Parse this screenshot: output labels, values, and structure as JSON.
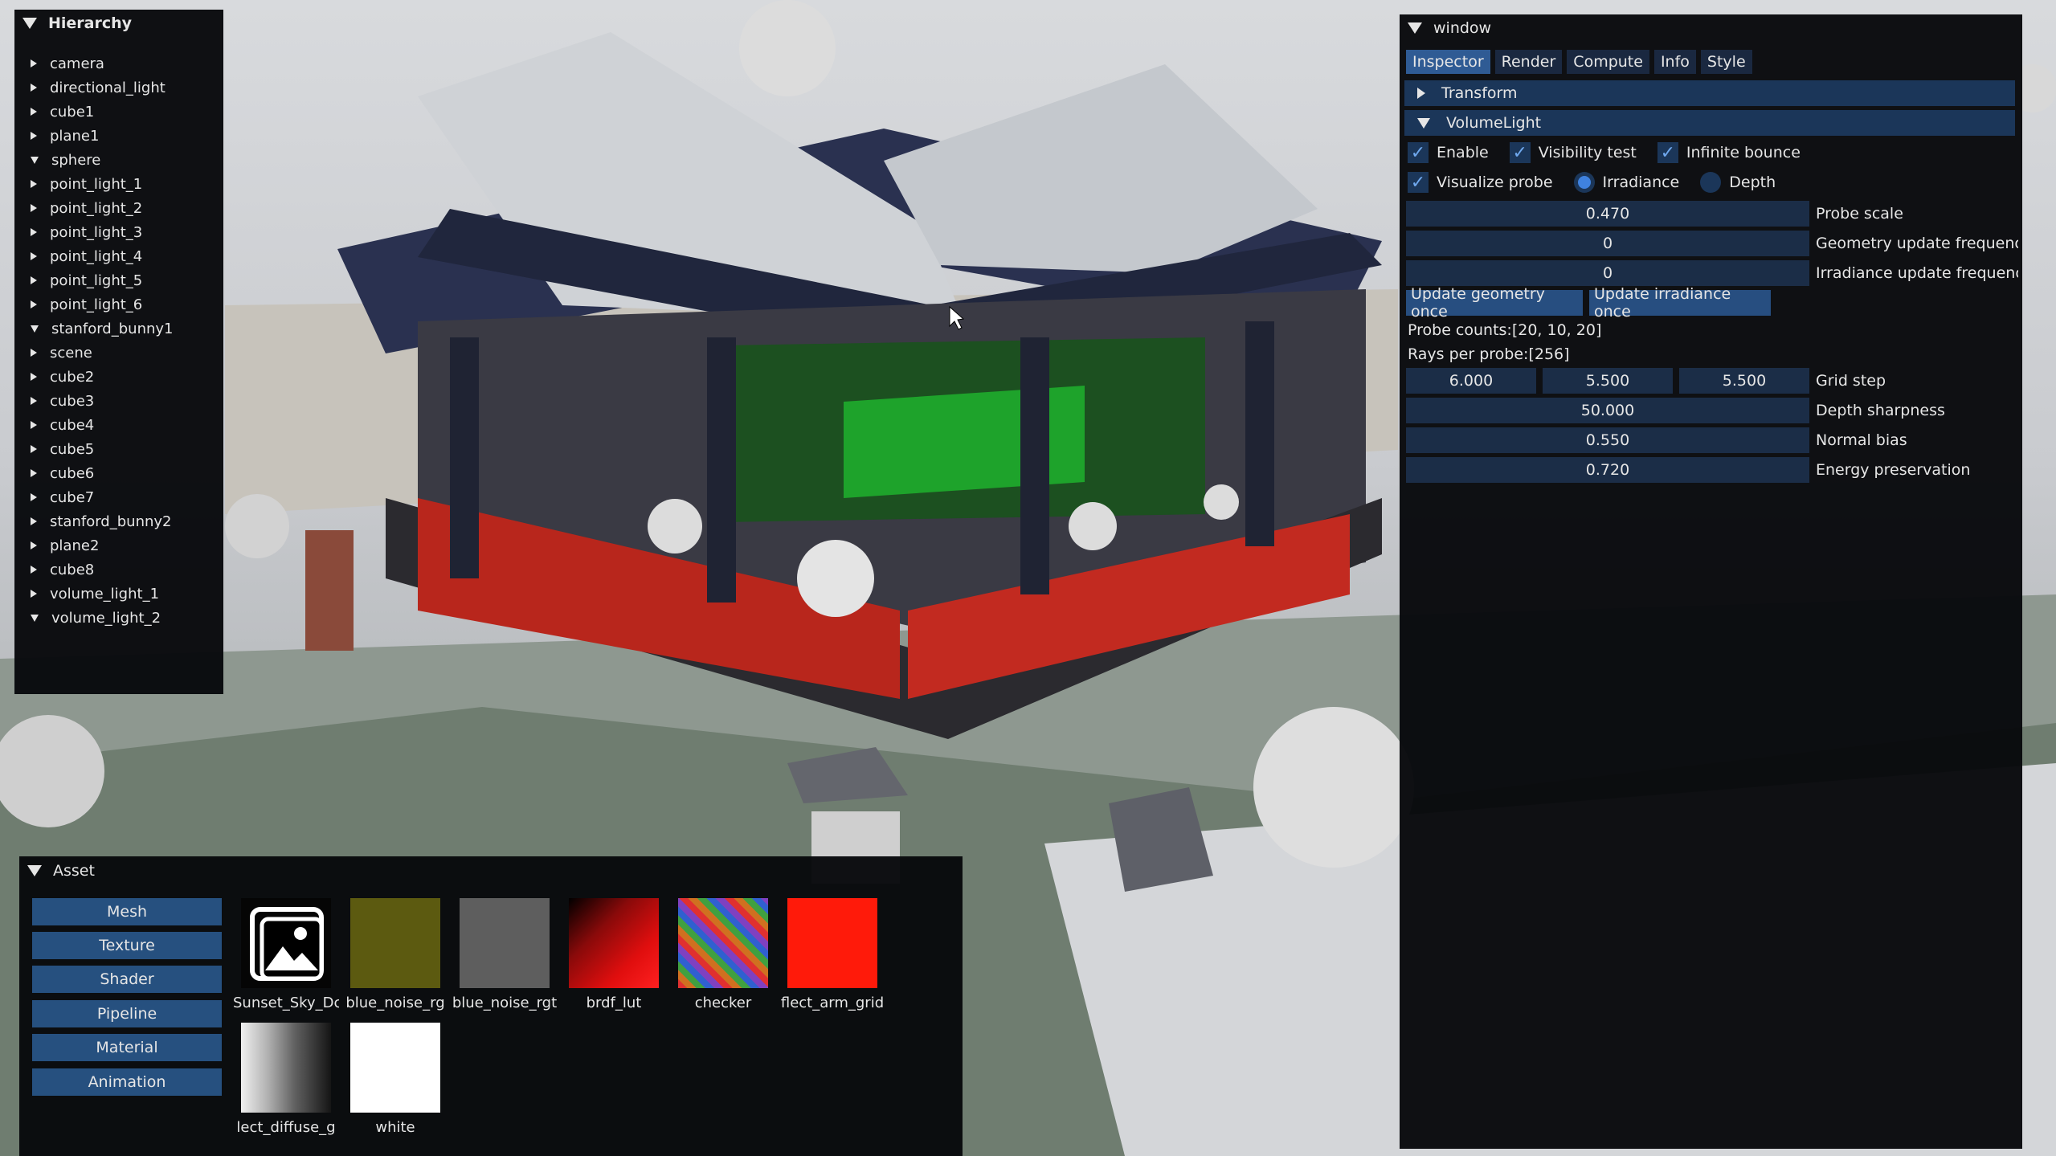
{
  "hierarchy": {
    "title": "Hierarchy",
    "items": [
      {
        "label": "camera",
        "expanded": false
      },
      {
        "label": "directional_light",
        "expanded": false
      },
      {
        "label": "cube1",
        "expanded": false
      },
      {
        "label": "plane1",
        "expanded": false
      },
      {
        "label": "sphere",
        "expanded": true
      },
      {
        "label": "point_light_1",
        "expanded": false
      },
      {
        "label": "point_light_2",
        "expanded": false
      },
      {
        "label": "point_light_3",
        "expanded": false
      },
      {
        "label": "point_light_4",
        "expanded": false
      },
      {
        "label": "point_light_5",
        "expanded": false
      },
      {
        "label": "point_light_6",
        "expanded": false
      },
      {
        "label": "stanford_bunny1",
        "expanded": true
      },
      {
        "label": "scene",
        "expanded": false
      },
      {
        "label": "cube2",
        "expanded": false
      },
      {
        "label": "cube3",
        "expanded": false
      },
      {
        "label": "cube4",
        "expanded": false
      },
      {
        "label": "cube5",
        "expanded": false
      },
      {
        "label": "cube6",
        "expanded": false
      },
      {
        "label": "cube7",
        "expanded": false
      },
      {
        "label": "stanford_bunny2",
        "expanded": false
      },
      {
        "label": "plane2",
        "expanded": false
      },
      {
        "label": "cube8",
        "expanded": false
      },
      {
        "label": "volume_light_1",
        "expanded": false
      },
      {
        "label": "volume_light_2",
        "expanded": true
      }
    ]
  },
  "window": {
    "title": "window",
    "tabs": [
      "Inspector",
      "Render",
      "Compute",
      "Info",
      "Style"
    ],
    "active_tab": "Inspector",
    "transform_header": "Transform",
    "volume_header": "VolumeLight",
    "enable_label": "Enable",
    "visibility_label": "Visibility test",
    "infinite_label": "Infinite bounce",
    "visualize_label": "Visualize probe",
    "irradiance_label": "Irradiance",
    "depth_label": "Depth",
    "probe_scale_value": "0.470",
    "probe_scale_label": "Probe scale",
    "geom_freq_value": "0",
    "geom_freq_label": "Geometry update frequency",
    "irr_freq_value": "0",
    "irr_freq_label": "Irradiance update frequenc",
    "update_geom_btn": "Update geometry once",
    "update_irr_btn": "Update irradiance once",
    "probe_counts": "Probe counts:[20, 10, 20]",
    "rays_per_probe": "Rays per probe:[256]",
    "grid_x": "6.000",
    "grid_y": "5.500",
    "grid_z": "5.500",
    "grid_label": "Grid step",
    "depth_sharp_value": "50.000",
    "depth_sharp_label": "Depth sharpness",
    "normal_bias_value": "0.550",
    "normal_bias_label": "Normal bias",
    "energy_value": "0.720",
    "energy_label": "Energy preservation"
  },
  "asset": {
    "title": "Asset",
    "categories": [
      "Mesh",
      "Texture",
      "Shader",
      "Pipeline",
      "Material",
      "Animation"
    ],
    "textures": [
      {
        "label": "Sunset_Sky_Dc",
        "color": "#ffffff"
      },
      {
        "label": "blue_noise_rg",
        "color": "#5c5a10"
      },
      {
        "label": "blue_noise_rgt",
        "color": "#5e5e5e"
      },
      {
        "label": "brdf_lut",
        "color": "#c01010"
      },
      {
        "label": "checker",
        "color": "#8040c0"
      },
      {
        "label": "flect_arm_grid",
        "color": "#ff1a0a"
      },
      {
        "label": "lect_diffuse_g",
        "color": "#909090"
      },
      {
        "label": "white",
        "color": "#ffffff"
      }
    ]
  }
}
